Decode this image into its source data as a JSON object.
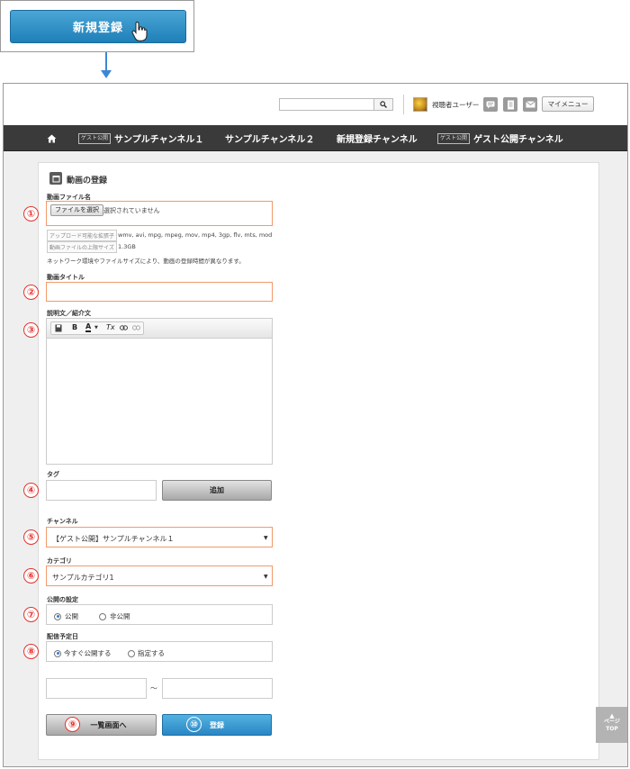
{
  "callout": {
    "new_button_label": "新規登録"
  },
  "header": {
    "search_placeholder": "",
    "user_name": "視聴者ユーザー",
    "mymenu_label": "マイメニュー"
  },
  "nav": {
    "guest_tag": "ゲスト公開",
    "items": [
      "サンプルチャンネル１",
      "サンプルチャンネル２",
      "新規登録チャンネル",
      "ゲスト公開チャンネル"
    ]
  },
  "form": {
    "title": "動画の登録",
    "file": {
      "label": "動画ファイル名",
      "choose_button": "ファイルを選択",
      "no_file_text": "選択されていません",
      "ext_tag": "アップロード可能な拡張子",
      "ext_values": "wmv, avi, mpg, mpeg, mov, mp4, 3gp, flv, mts, mod",
      "size_tag": "動画ファイルの上限サイズ",
      "size_value": "1.3GB",
      "note": "ネットワーク環境やファイルサイズにより、動画の登録時間が異なります。"
    },
    "video_title": {
      "label": "動画タイトル",
      "value": ""
    },
    "description": {
      "label": "説明文／紹介文",
      "toolbar": [
        "save-icon",
        "bold-icon",
        "font-color-icon",
        "clear-format-icon",
        "link-icon",
        "unlink-icon"
      ],
      "bold_glyph": "B",
      "color_glyph": "A",
      "clear_glyph": "Tx",
      "value": ""
    },
    "tag": {
      "label": "タグ",
      "value": "",
      "add_button": "追加"
    },
    "channel": {
      "label": "チャンネル",
      "selected": "【ゲスト公開】サンプルチャンネル１"
    },
    "category": {
      "label": "カテゴリ",
      "selected": "サンプルカテゴリ1"
    },
    "visibility": {
      "label": "公開の設定",
      "options": [
        "公開",
        "非公開"
      ],
      "selected_index": 0
    },
    "schedule": {
      "label": "配信予定日",
      "options": [
        "今すぐ公開する",
        "指定する"
      ],
      "selected_index": 0,
      "separator": "～",
      "from_value": "",
      "to_value": ""
    },
    "back_button": "一覧画面へ",
    "submit_button": "登録"
  },
  "markers": [
    "①",
    "②",
    "③",
    "④",
    "⑤",
    "⑥",
    "⑦",
    "⑧",
    "⑨",
    "⑩"
  ],
  "page_top": {
    "line1": "ページ",
    "line2": "TOP"
  },
  "colors": {
    "accent_blue": "#2a86c4",
    "marker_red": "#e5322d",
    "highlight_orange": "#f29a6a",
    "nav_bg": "#3a3a3a"
  }
}
